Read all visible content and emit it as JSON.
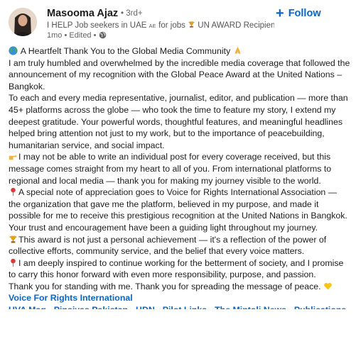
{
  "author": {
    "name": "Masooma Ajaz",
    "degree": "• 3rd+",
    "headline_prefix": "I HELP Job seekers in UAE",
    "headline_flag": "AE",
    "headline_mid": "for jobs",
    "headline_suffix": "UN AWARD Recipient | ...",
    "meta": "1mo • Edited •"
  },
  "follow": {
    "label": "Follow"
  },
  "post": {
    "p1": "A Heartfelt Thank You to the Global Media Community",
    "p2": "I am truly humbled and overwhelmed by the incredible media coverage that followed the announcement of my recognition with the Global Peace Award at the United Nations – Bangkok.",
    "p3": "To each and every media representative, journalist, editor, and publication — more than 45+ platforms across the globe — who took the time to feature my story, I extend my deepest gratitude. Your powerful words, thoughtful features, and meaningful headlines helped bring attention not just to my work, but to the importance of peacebuilding, humanitarian service, and social impact.",
    "p4": "I may not be able to write an individual post for every coverage received, but this message comes straight from my heart to all of you. From international platforms to regional and local media — thank you for making my journey visible to the world.",
    "p5": "A special note of appreciation goes to Voice for Rights International Association — the organization that gave me the platform, believed in my purpose, and made it possible for me to receive this prestigious recognition at the United Nations in Bangkok. Your trust and encouragement have been a guiding light throughout my journey.",
    "p6": "This award is not just a personal achievement — it's a reflection of the power of collective efforts, community service, and the belief that every voice matters.",
    "p7": "I am deeply inspired to continue working for the betterment of society, and I promise to carry this honor forward with even more responsibility, purpose, and passion.",
    "p8": "Thank you for standing with me. Thank you for spreading the message of peace.",
    "link": "Voice For Rights International",
    "cutoff_line": "UVA Mag · Pinsiyas Pakistan · HDN · Pilot Links · The Mintoli News · Publications"
  },
  "icons": {
    "globe": "globe-emoji-icon",
    "pray": "folded-hands-icon",
    "pointing": "backhand-index-pointing-right-icon",
    "pin": "round-pushpin-icon",
    "trophy": "trophy-icon",
    "heart": "yellow-heart-icon",
    "visibility": "globe-visibility-icon"
  },
  "colors": {
    "accent": "#0a66c2",
    "text": "#1d1d1d",
    "muted": "#666666"
  }
}
